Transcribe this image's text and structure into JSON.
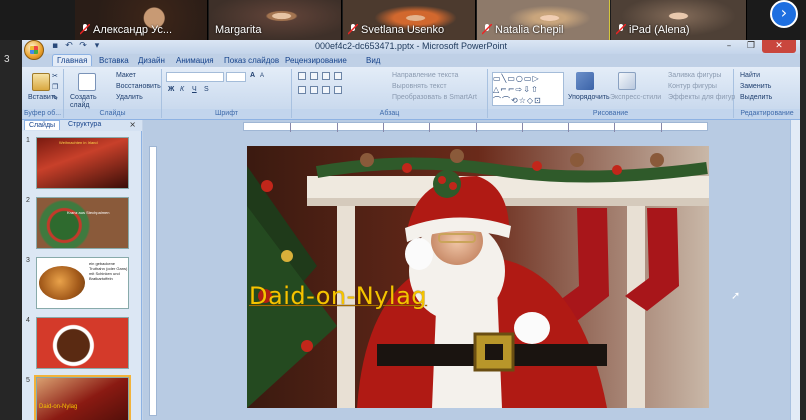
{
  "zoom": {
    "participants": [
      {
        "name": "Александр Ус...",
        "muted": true
      },
      {
        "name": "Margarita",
        "muted": false
      },
      {
        "name": "Svetlana Usenko",
        "muted": true
      },
      {
        "name": "Natalia Chepil",
        "muted": true
      },
      {
        "name": "iPad (Alena)",
        "muted": true
      }
    ],
    "left_label": "3"
  },
  "window": {
    "title": "000ef4c2-dc653471.pptx - Microsoft PowerPoint"
  },
  "tabs": [
    "Главная",
    "Вставка",
    "Дизайн",
    "Анимация",
    "Показ слайдов",
    "Рецензирование",
    "Вид"
  ],
  "ribbon": {
    "clipboard": {
      "name": "Буфер об...",
      "paste": "Вставить"
    },
    "slides": {
      "name": "Слайды",
      "create": "Создать слайд",
      "layout": "Макет",
      "reset": "Восстановить",
      "delete": "Удалить"
    },
    "font": {
      "name": "Шрифт",
      "bold": "Ж",
      "italic": "К",
      "underline": "Ч",
      "strike": "S",
      "size_up": "A",
      "size_down": "A"
    },
    "paragraph": {
      "name": "Абзац",
      "direction": "Направление текста",
      "align": "Выровнять текст",
      "smartart": "Преобразовать в SmartArt"
    },
    "drawing": {
      "name": "Рисование",
      "arrange": "Упорядочить",
      "styles": "Экспресс-стили",
      "fill": "Заливка фигуры",
      "outline": "Контур фигуры",
      "effects": "Эффекты для фигур"
    },
    "editing": {
      "name": "Редактирование",
      "find": "Найти",
      "replace": "Заменить",
      "select": "Выделить"
    }
  },
  "pane": {
    "tab_slides": "Слайды",
    "tab_outline": "Структура",
    "close": "×",
    "thumbnails": [
      {
        "num": "1",
        "text": "Weihnachten in Irland"
      },
      {
        "num": "2",
        "text": "Kranz aus Stechpalmen"
      },
      {
        "num": "3",
        "text": "ein gebackene Truthahn (oder Gans) mit Schinken und Bratkartoffeln"
      },
      {
        "num": "4",
        "text": ""
      },
      {
        "num": "5",
        "text": "Daid-on-Nylag"
      }
    ]
  },
  "slide": {
    "title": "Daid-on-Nylag"
  },
  "colors": {
    "ribbon_bg": "#dbe6f4",
    "slide_title": "#f5c400",
    "zoom_next": "#1e6fe0"
  }
}
